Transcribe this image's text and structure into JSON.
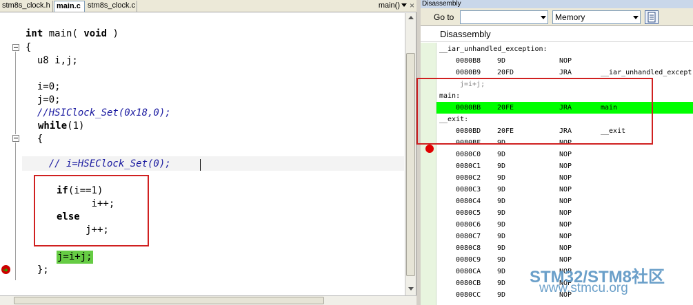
{
  "editor": {
    "tabs": [
      {
        "label": "stm8s_clock.h"
      },
      {
        "label": "main.c"
      },
      {
        "label": "stm8s_clock.c"
      }
    ],
    "function_selector": "main()",
    "close_icon": "×"
  },
  "code": {
    "lines": [
      {
        "kw1": "int",
        "t1": " main( ",
        "kw2": "void",
        "t2": " )"
      },
      "{",
      "  u8 i,j;",
      "  i=0;",
      "  j=0;",
      "  //HSIClock_Set(0x18,0);",
      {
        "kw": "while",
        "t": "(1)"
      },
      "  {",
      "    // i=HSEClock_Set(0);",
      {
        "kw": "if",
        "t": "(i==1)"
      },
      "      i++;",
      "else",
      "     j++;",
      "j=i+j;",
      "  };"
    ]
  },
  "disassembly": {
    "window_title": "Disassembly",
    "goto_label": "Go to",
    "goto_value": "",
    "memory_select": "Memory",
    "header": "Disassembly",
    "rows": [
      {
        "type": "label",
        "text": "__iar_unhandled_exception:"
      },
      {
        "type": "instr",
        "addr": "0080B8",
        "op": "9D",
        "mn": "NOP",
        "arg": ""
      },
      {
        "type": "instr",
        "addr": "0080B9",
        "op": "20FD",
        "mn": "JRA",
        "arg": "__iar_unhandled_except"
      },
      {
        "type": "src",
        "text": "j=i+j;"
      },
      {
        "type": "label",
        "text": "main:"
      },
      {
        "type": "instr",
        "addr": "0080BB",
        "op": "20FE",
        "mn": "JRA",
        "arg": "main",
        "current": true
      },
      {
        "type": "label",
        "text": "__exit:"
      },
      {
        "type": "instr",
        "addr": "0080BD",
        "op": "20FE",
        "mn": "JRA",
        "arg": "__exit"
      },
      {
        "type": "instr",
        "addr": "0080BF",
        "op": "9D",
        "mn": "NOP",
        "arg": ""
      },
      {
        "type": "instr",
        "addr": "0080C0",
        "op": "9D",
        "mn": "NOP",
        "arg": ""
      },
      {
        "type": "instr",
        "addr": "0080C1",
        "op": "9D",
        "mn": "NOP",
        "arg": ""
      },
      {
        "type": "instr",
        "addr": "0080C2",
        "op": "9D",
        "mn": "NOP",
        "arg": ""
      },
      {
        "type": "instr",
        "addr": "0080C3",
        "op": "9D",
        "mn": "NOP",
        "arg": ""
      },
      {
        "type": "instr",
        "addr": "0080C4",
        "op": "9D",
        "mn": "NOP",
        "arg": ""
      },
      {
        "type": "instr",
        "addr": "0080C5",
        "op": "9D",
        "mn": "NOP",
        "arg": ""
      },
      {
        "type": "instr",
        "addr": "0080C6",
        "op": "9D",
        "mn": "NOP",
        "arg": ""
      },
      {
        "type": "instr",
        "addr": "0080C7",
        "op": "9D",
        "mn": "NOP",
        "arg": ""
      },
      {
        "type": "instr",
        "addr": "0080C8",
        "op": "9D",
        "mn": "NOP",
        "arg": ""
      },
      {
        "type": "instr",
        "addr": "0080C9",
        "op": "9D",
        "mn": "NOP",
        "arg": ""
      },
      {
        "type": "instr",
        "addr": "0080CA",
        "op": "9D",
        "mn": "NOP",
        "arg": ""
      },
      {
        "type": "instr",
        "addr": "0080CB",
        "op": "9D",
        "mn": "NOP",
        "arg": ""
      },
      {
        "type": "instr",
        "addr": "0080CC",
        "op": "9D",
        "mn": "NOP",
        "arg": ""
      }
    ]
  },
  "watermark": {
    "line1": "STM32/STM8社区",
    "line2": "www.stmcu.org"
  },
  "icons": {
    "fold": "fold-minus-icon",
    "breakpoint": "breakpoint-icon",
    "program_counter": "program-counter-arrow-icon",
    "document": "document-icon"
  },
  "colors": {
    "current_line_highlight": "#00ff00",
    "statement_highlight": "#66cc44",
    "annotation_box": "#d02020",
    "breakpoint": "#e00000"
  }
}
